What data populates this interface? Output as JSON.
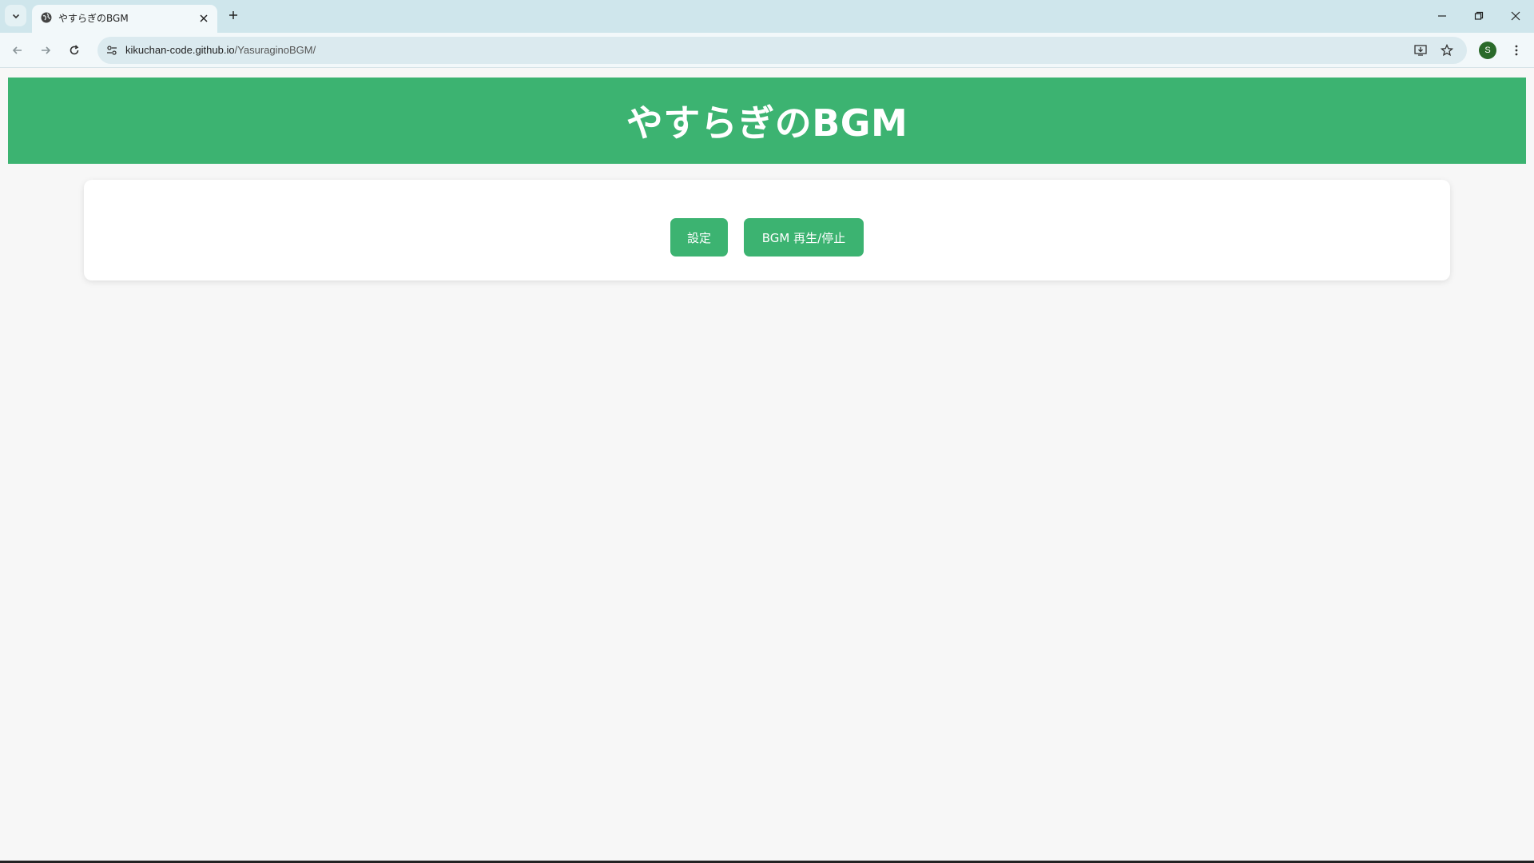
{
  "browser": {
    "tab": {
      "title": "やすらぎのBGM"
    },
    "address": {
      "host": "kikuchan-code.github.io",
      "path": "/YasuraginoBGM/"
    },
    "profile_initial": "S"
  },
  "page": {
    "title": "やすらぎのBGM",
    "buttons": {
      "settings": "設定",
      "play_toggle": "BGM 再生/停止"
    }
  },
  "colors": {
    "accent": "#3cb371",
    "background": "#f7f7f7",
    "card": "#ffffff"
  }
}
